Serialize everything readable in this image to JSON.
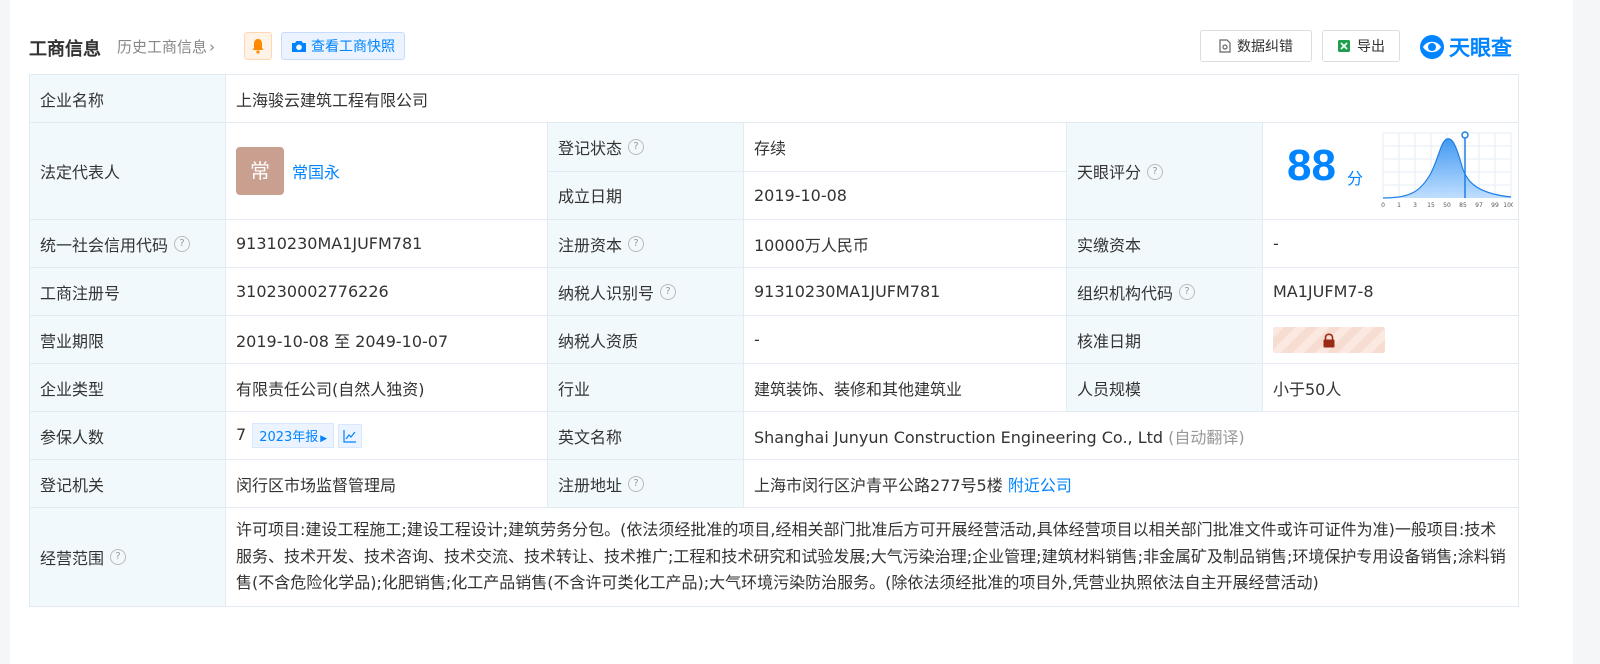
{
  "header": {
    "title": "工商信息",
    "history_link": "历史工商信息",
    "snapshot_button": "查看工商快照",
    "correction_button": "数据纠错",
    "export_button": "导出",
    "logo_text": "天眼查"
  },
  "company": {
    "name_label": "企业名称",
    "name": "上海骏云建筑工程有限公司",
    "legal_rep_label": "法定代表人",
    "legal_rep_avatar": "常",
    "legal_rep_name": "常国永",
    "status_label": "登记状态",
    "status": "存续",
    "founded_label": "成立日期",
    "founded": "2019-10-08",
    "score_label": "天眼评分",
    "score": "88",
    "score_unit": "分",
    "score_axis": [
      "0",
      "1",
      "3",
      "15",
      "50",
      "85",
      "97",
      "99",
      "100"
    ],
    "credit_code_label": "统一社会信用代码",
    "credit_code": "91310230MA1JUFM781",
    "reg_capital_label": "注册资本",
    "reg_capital": "10000万人民币",
    "paid_capital_label": "实缴资本",
    "paid_capital": "-",
    "reg_no_label": "工商注册号",
    "reg_no": "310230002776226",
    "taxpayer_id_label": "纳税人识别号",
    "taxpayer_id": "91310230MA1JUFM781",
    "org_code_label": "组织机构代码",
    "org_code": "MA1JUFM7-8",
    "term_label": "营业期限",
    "term": "2019-10-08 至 2049-10-07",
    "taxpayer_qual_label": "纳税人资质",
    "taxpayer_qual": "-",
    "approval_date_label": "核准日期",
    "type_label": "企业类型",
    "type": "有限责任公司(自然人独资)",
    "industry_label": "行业",
    "industry": "建筑装饰、装修和其他建筑业",
    "staff_size_label": "人员规模",
    "staff_size": "小于50人",
    "insured_label": "参保人数",
    "insured": "7",
    "insured_year_button": "2023年报",
    "english_name_label": "英文名称",
    "english_name": "Shanghai Junyun Construction Engineering Co., Ltd",
    "english_name_note": "(自动翻译)",
    "authority_label": "登记机关",
    "authority": "闵行区市场监督管理局",
    "address_label": "注册地址",
    "address": "上海市闵行区沪青平公路277号5楼",
    "nearby_link": "附近公司",
    "scope_label": "经营范围",
    "scope": "许可项目:建设工程施工;建设工程设计;建筑劳务分包。(依法须经批准的项目,经相关部门批准后方可开展经营活动,具体经营项目以相关部门批准文件或许可证件为准)一般项目:技术服务、技术开发、技术咨询、技术交流、技术转让、技术推广;工程和技术研究和试验发展;大气污染治理;企业管理;建筑材料销售;非金属矿及制品销售;环境保护专用设备销售;涂料销售(不含危险化学品);化肥销售;化工产品销售(不含许可类化工产品);大气环境污染防治服务。(除依法须经批准的项目外,凭营业执照依法自主开展经营活动)"
  },
  "colors": {
    "accent": "#0084ff",
    "label_bg": "#f2f9fc",
    "status_green": "#009944",
    "avatar_bg": "#c9a08f"
  }
}
